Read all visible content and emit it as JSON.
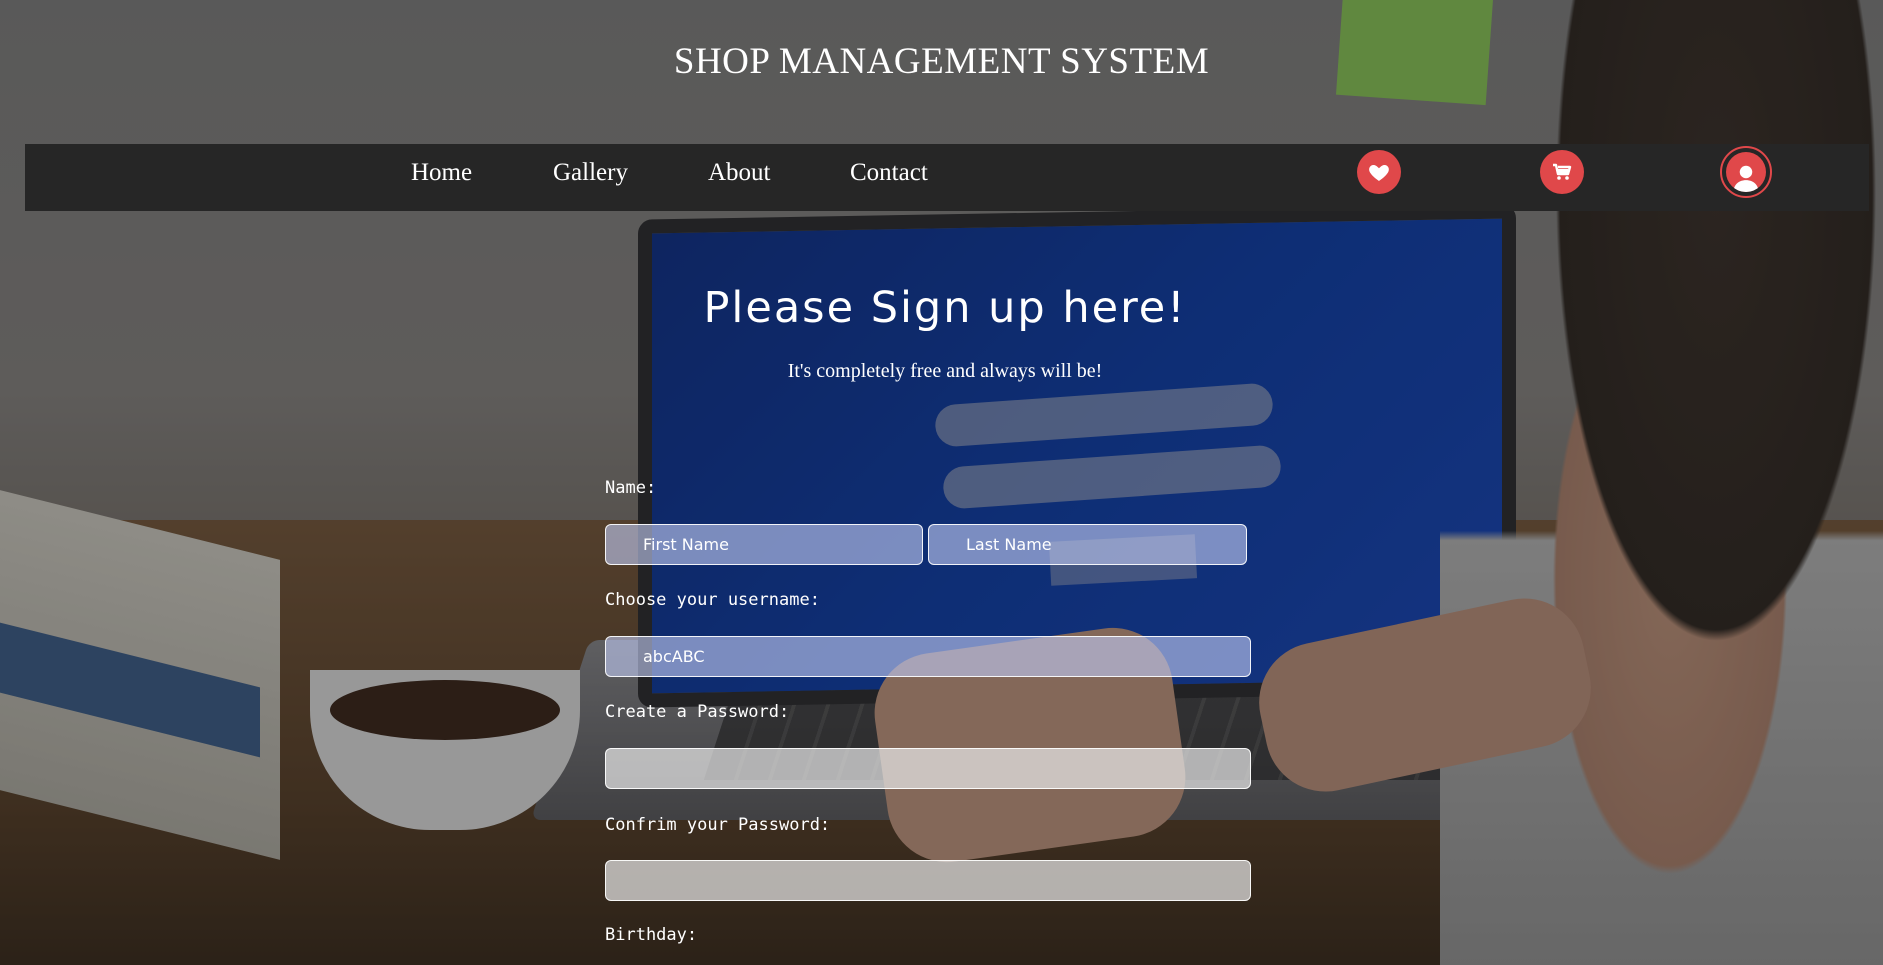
{
  "header": {
    "title": "SHOP MANAGEMENT SYSTEM"
  },
  "nav": {
    "items": [
      {
        "label": "Home"
      },
      {
        "label": "Gallery"
      },
      {
        "label": "About"
      },
      {
        "label": "Contact"
      }
    ],
    "icons": [
      "heart-icon",
      "cart-icon",
      "user-icon"
    ]
  },
  "signup": {
    "heading": "Please Sign up here!",
    "subheading": "It's completely free and always will be!",
    "name_label": "Name:",
    "first_name_placeholder": "First Name",
    "last_name_placeholder": "Last Name",
    "username_label": "Choose your username:",
    "username_value": "abcABC",
    "password_label": "Create a Password:",
    "password_value": "",
    "confirm_label": "Confrim your Password:",
    "confirm_value": "",
    "birthday_label": "Birthday:"
  },
  "colors": {
    "accent": "#e0484a",
    "navbar": "#262626"
  }
}
